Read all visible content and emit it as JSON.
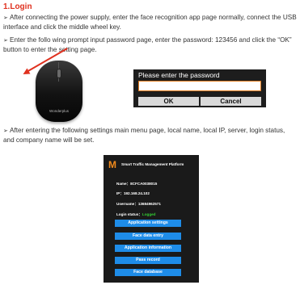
{
  "heading": "1.Login",
  "bullet_glyph": "➢",
  "paragraphs": [
    "After connecting the power supply, enter the face recognition app page normally, connect the USB interface and click the middle wheel key.",
    "Enter the follo wing prompt input password page, enter the password: 123456 and click the “OK” button to enter the setting page.",
    "After entering the following settings main menu page, local name, local IP, server, login status, and company name will be set."
  ],
  "mouse": {
    "brand": "Wonderplus"
  },
  "password_dialog": {
    "title": "Please enter the password",
    "input_value": "",
    "ok_label": "OK",
    "cancel_label": "Cancel"
  },
  "app": {
    "logo": "M",
    "title": "Smart Traffic Management Platform",
    "name_label": "Name：",
    "name_value": "8CFCA0038015",
    "ip_label": "IP：",
    "ip_value": "192.168.24.102",
    "username_label": "Username：",
    "username_value": "13684962571",
    "login_label": "Login status：",
    "login_value": "Logged",
    "menu": [
      "Application settings",
      "Face data entry",
      "Application information",
      "Pass record",
      "Face database"
    ]
  },
  "colors": {
    "heading": "#e0311f",
    "dialog_bg": "#1d1d1d",
    "input_border": "#e07b1e",
    "app_bg": "#1a1a1a",
    "logo": "#f08a1c",
    "menu_button": "#1e8ce8",
    "logged_status": "#33cc33"
  }
}
